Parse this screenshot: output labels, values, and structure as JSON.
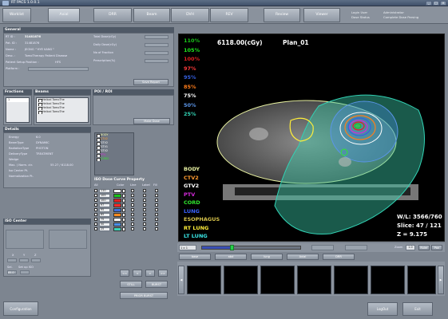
{
  "window": {
    "title": "RT PACS 1.0.0.1"
  },
  "tabs": [
    {
      "label": "Worklist",
      "active": false
    },
    {
      "label": "Axial",
      "active": true
    },
    {
      "label": "DRR",
      "active": false
    },
    {
      "label": "Beam",
      "active": false
    },
    {
      "label": "DVH",
      "active": false
    },
    {
      "label": "REV",
      "active": false
    },
    {
      "label": "Review",
      "active": false
    },
    {
      "label": "Viewer",
      "active": false
    }
  ],
  "login": {
    "user_label": "Login User",
    "user_value": "Administrator",
    "status_label": "Dose Status",
    "status_value": "Complete Dose Parsing"
  },
  "general": {
    "title": "General",
    "rt_id_label": "RT ID :",
    "rt_id": "31481876",
    "pat_id_label": "Pat. ID :",
    "pat_id": "31481876",
    "name_label": "Name :",
    "name": "JEONG ^HYE KANG^",
    "desc_label": "Desc. :",
    "desc": "TomoTherapy Patient Disease",
    "setup_label": "Patient Setup Position :",
    "setup": "HFS",
    "platform_label": "Platform :",
    "total_dose_label": "Total Dose(cGy)",
    "daily_dose_label": "Daily Dose(cGy)",
    "fractions_label": "No of Fraction",
    "prescription_label": "Prescription(%)",
    "save_report": "Save Report"
  },
  "fractions": {
    "title": "Fractions",
    "items": [
      "1"
    ]
  },
  "beams": {
    "title": "Beams",
    "items": [
      "Helical TomoThe",
      "Helical TomoThe",
      "Helical TomoThe",
      "Helical TomoThe"
    ]
  },
  "poi": {
    "title": "POI / ROI",
    "items": [
      "BODY",
      "CTV2",
      "GTV2",
      "GTV1",
      "GTV2",
      "PTV",
      "CORD"
    ],
    "make_dose": "Make Dose"
  },
  "details": {
    "title": "Details",
    "rows": [
      {
        "k": "Energy",
        "v": "6.0"
      },
      {
        "k": "BeamType",
        "v": "DYNAMIC"
      },
      {
        "k": "RadiationType",
        "v": "PHOTON"
      },
      {
        "k": "DeliveryType",
        "v": "TREATMENT"
      },
      {
        "k": "Wedge",
        "v": ""
      },
      {
        "k": "Max. ( Norm. ctr.",
        "v": "55.27  /  6118.00"
      },
      {
        "k": "Iso Center Pt.",
        "v": ""
      },
      {
        "k": "Normalization Pt.",
        "v": ""
      }
    ]
  },
  "iso_curve": {
    "title": "ISO Dose Curve Property",
    "headers": [
      "All",
      "Color",
      "Line",
      "Label",
      "Fill"
    ],
    "levels": [
      "110",
      "105",
      "100",
      "97",
      "95",
      "85",
      "75",
      "50",
      "25"
    ],
    "colors": [
      "#ffffff",
      "#19c419",
      "#e02020",
      "#ff2a2a",
      "#3b6fe0",
      "#ff8a1d",
      "#ffffff",
      "#4a8ee8",
      "#3ad3b8"
    ]
  },
  "iso_center": {
    "title": "ISO Center",
    "labels": [
      "X",
      "Y",
      "Z"
    ],
    "sel_label": "Sel.",
    "set_iso": "Set up ISO",
    "value": "85.0"
  },
  "nav_buttons": {
    "first": "<<",
    "prev": "<",
    "next": ">",
    "last": ">>",
    "still": "STILL",
    "burst": "BURST",
    "prior_burst": "PRIOR BURST"
  },
  "viewer": {
    "dose_header": "6118.00(cGy)",
    "plan": "Plan_01",
    "percent_labels": [
      {
        "text": "110%",
        "color": "#19c419"
      },
      {
        "text": "105%",
        "color": "#1ee81e"
      },
      {
        "text": "100%",
        "color": "#e02020"
      },
      {
        "text": "97%",
        "color": "#ff3a3a"
      },
      {
        "text": "95%",
        "color": "#3560e0"
      },
      {
        "text": "85%",
        "color": "#ff7d1a"
      },
      {
        "text": "75%",
        "color": "#ffffff"
      },
      {
        "text": "50%",
        "color": "#5a95e8"
      },
      {
        "text": "25%",
        "color": "#32d3b5"
      }
    ],
    "structures": [
      {
        "text": "BODY",
        "color": "#e7f0a0"
      },
      {
        "text": "CTV2",
        "color": "#ff9b2f"
      },
      {
        "text": "GTV2",
        "color": "#ffffff"
      },
      {
        "text": "PTV",
        "color": "#d229d9"
      },
      {
        "text": "CORD",
        "color": "#30e62e"
      },
      {
        "text": "LUNG",
        "color": "#3b63ff"
      },
      {
        "text": "ESOPHAGUS",
        "color": "#d5c14a"
      },
      {
        "text": "RT LUNG",
        "color": "#ffee3a"
      },
      {
        "text": "LT LUNG",
        "color": "#39e6e6"
      }
    ],
    "window_level": "W/L: 3566/760",
    "slice": "Slice: 47 / 121",
    "z": "Z = 9.175"
  },
  "controls": {
    "layout": "1 x 1",
    "zoom_label": "Zoom",
    "zoom": "1.0",
    "ruler": "Ruler",
    "pan": "Pan",
    "slider_fraction": 0.3
  },
  "thumb_tabs": [
    "base",
    "abd",
    "lung",
    "Axial",
    "DRR"
  ],
  "footer": {
    "configuration": "Configuration",
    "logout": "LogOut",
    "exit": "Exit"
  }
}
